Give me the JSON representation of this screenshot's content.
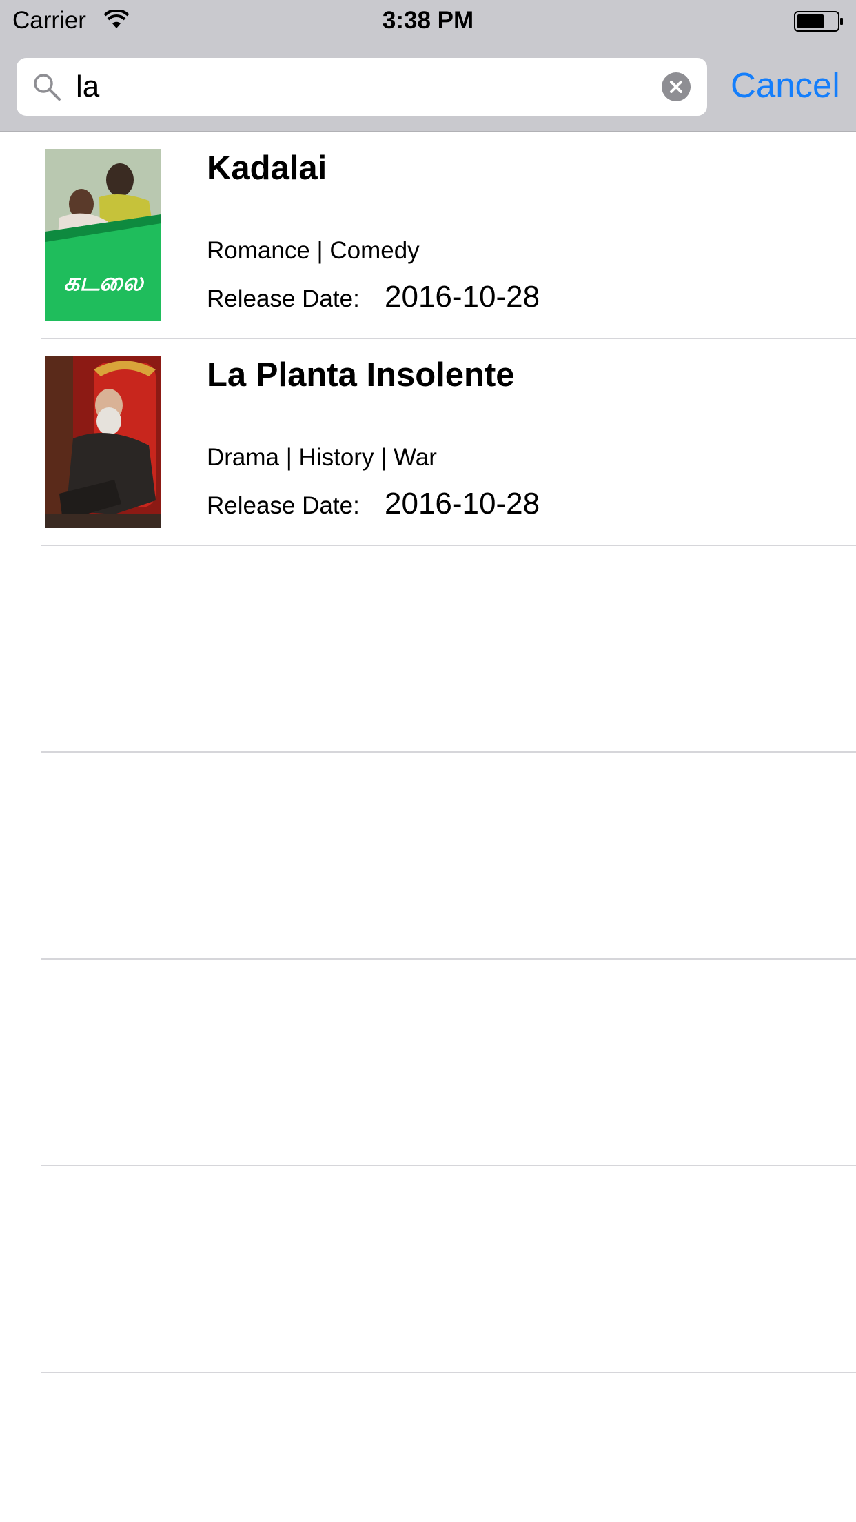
{
  "status_bar": {
    "carrier": "Carrier",
    "time": "3:38 PM",
    "icons": [
      "wifi-icon",
      "battery-icon"
    ]
  },
  "search": {
    "value": "la",
    "icons": [
      "search-icon",
      "clear-icon"
    ],
    "cancel_label": "Cancel"
  },
  "colors": {
    "header_bg": "#c9c9ce",
    "accent": "#147efb",
    "separator": "#d6d6da"
  },
  "results": [
    {
      "title": "Kadalai",
      "genres": "Romance | Comedy",
      "release_label": "Release Date:",
      "release_date": "2016-10-28",
      "poster_text": "கடலை"
    },
    {
      "title": "La Planta Insolente",
      "genres": "Drama | History | War",
      "release_label": "Release Date:",
      "release_date": "2016-10-28"
    }
  ]
}
